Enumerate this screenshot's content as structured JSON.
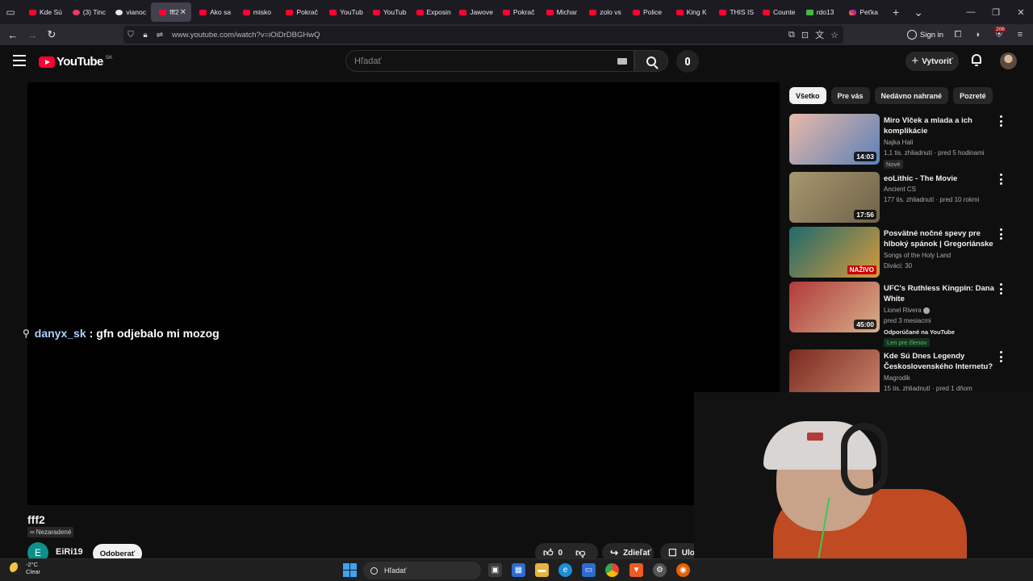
{
  "browser": {
    "tabs": [
      {
        "label": "Kde Sú",
        "fav": "yt"
      },
      {
        "label": "(3) Tinc",
        "fav": "tinder"
      },
      {
        "label": "vianoc",
        "fav": "pie"
      },
      {
        "label": "fff2",
        "fav": "yt",
        "active": true
      },
      {
        "label": "Ako sa",
        "fav": "yt"
      },
      {
        "label": "misko",
        "fav": "yt"
      },
      {
        "label": "Pokrač",
        "fav": "yt"
      },
      {
        "label": "YouTub",
        "fav": "yt"
      },
      {
        "label": "YouTub",
        "fav": "yt"
      },
      {
        "label": "Exposin",
        "fav": "yt"
      },
      {
        "label": "Jawove",
        "fav": "yt"
      },
      {
        "label": "Pokrač",
        "fav": "yt"
      },
      {
        "label": "Michar",
        "fav": "yt"
      },
      {
        "label": "zolo vs",
        "fav": "yt"
      },
      {
        "label": "Police",
        "fav": "yt"
      },
      {
        "label": "King K",
        "fav": "yt"
      },
      {
        "label": "THIS IS",
        "fav": "yt"
      },
      {
        "label": "Counte",
        "fav": "yt"
      },
      {
        "label": "rdo13",
        "fav": "green"
      },
      {
        "label": "Peťka",
        "fav": "ig"
      }
    ],
    "url": "www.youtube.com/watch?v=iOiDrDBGHwQ",
    "signin_label": "Sign in",
    "ext_badge": "206"
  },
  "youtube": {
    "logo_text": "YouTube",
    "country_code": "SK",
    "search_placeholder": "Hľadať",
    "create_label": "Vytvoriť"
  },
  "player": {
    "chat_user": "danyx_sk",
    "chat_sep": ":",
    "chat_text": "gfn odjebalo mi mozog"
  },
  "video": {
    "title": "fff2",
    "visibility": "Nezaradené",
    "channel_initial": "E",
    "channel_name": "EiRi19",
    "subscribe_label": "Odoberať",
    "likes": "0",
    "share_label": "Zdieľať",
    "save_label": "Ulož"
  },
  "sidebar": {
    "chips": [
      "Všetko",
      "Pre vás",
      "Nedávno nahrané",
      "Pozreté"
    ],
    "items": [
      {
        "title": "Miro Vlček a mlada a ich komplikácie",
        "channel": "Najka Hali",
        "meta": "1,1 tis. zhliadnutí · pred 5 hodinami",
        "badge": "Nové",
        "duration": "14:03",
        "thumb_colors": [
          "#e8b9a8",
          "#5c80b8"
        ]
      },
      {
        "title": "eoLithic - The Movie",
        "channel": "Ancient CS",
        "meta": "177 tis. zhliadnutí · pred 10 rokmi",
        "duration": "17:56",
        "thumb_colors": [
          "#a89870",
          "#6e6248"
        ]
      },
      {
        "title": "Posvätné nočné spevy pre hlboký spánok | Gregoriánske ...",
        "channel": "Songs of the Holy Land",
        "meta": "Diváci: 30",
        "live": "NAŽIVO",
        "thumb_colors": [
          "#1f6a6c",
          "#d79a3c"
        ]
      },
      {
        "title": "UFC's Ruthless Kingpin: Dana White",
        "channel": "Lionel Rivera",
        "meta": "pred 3 mesiacmi",
        "recommended": "Odporúčané na YouTube",
        "member": "Len pre členov",
        "duration": "45:00",
        "thumb_colors": [
          "#b23a3a",
          "#d6b08a"
        ]
      },
      {
        "title": "Kde Sú Dnes Legendy Československého Internetu?",
        "channel": "Magrodik",
        "meta": "15 tis. zhliadnutí · pred 1 dňom",
        "thumb_colors": [
          "#7a2a20",
          "#c9866c"
        ]
      }
    ]
  },
  "taskbar": {
    "temperature": "-2°C",
    "condition": "Clear",
    "search_label": "Hľadať"
  }
}
